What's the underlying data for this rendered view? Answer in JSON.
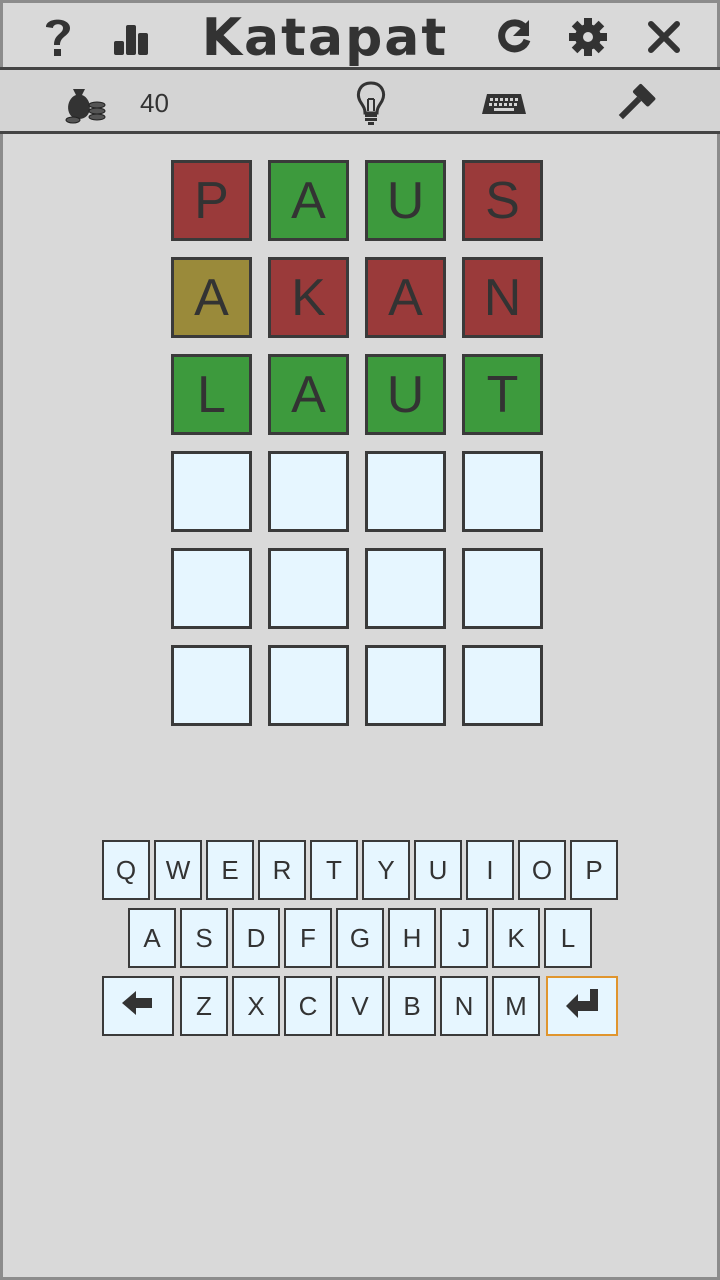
{
  "app": {
    "title": "Katapat"
  },
  "header": {
    "icons": [
      "help-icon",
      "stats-icon",
      "restart-icon",
      "settings-icon",
      "close-icon"
    ]
  },
  "toolbar": {
    "coins": "40",
    "icons": [
      "coin-bag-icon",
      "hint-bulb-icon",
      "keyboard-icon",
      "hammer-icon"
    ]
  },
  "colors": {
    "correct": "#3d9a3d",
    "absent": "#9a3a3a",
    "present": "#9a8a3a",
    "empty": "#e6f6ff",
    "enter_border": "#e0952e"
  },
  "board": {
    "rows": [
      {
        "letters": [
          "P",
          "A",
          "U",
          "S"
        ],
        "states": [
          "absent",
          "correct",
          "correct",
          "absent"
        ]
      },
      {
        "letters": [
          "A",
          "K",
          "A",
          "N"
        ],
        "states": [
          "present",
          "absent",
          "absent",
          "absent"
        ]
      },
      {
        "letters": [
          "L",
          "A",
          "U",
          "T"
        ],
        "states": [
          "correct",
          "correct",
          "correct",
          "correct"
        ]
      },
      {
        "letters": [
          "",
          "",
          "",
          ""
        ],
        "states": [
          "empty",
          "empty",
          "empty",
          "empty"
        ]
      },
      {
        "letters": [
          "",
          "",
          "",
          ""
        ],
        "states": [
          "empty",
          "empty",
          "empty",
          "empty"
        ]
      },
      {
        "letters": [
          "",
          "",
          "",
          ""
        ],
        "states": [
          "empty",
          "empty",
          "empty",
          "empty"
        ]
      }
    ]
  },
  "keyboard": {
    "row1": [
      {
        "k": "Q",
        "s": "none"
      },
      {
        "k": "W",
        "s": "none"
      },
      {
        "k": "E",
        "s": "none"
      },
      {
        "k": "R",
        "s": "none"
      },
      {
        "k": "T",
        "s": "correct"
      },
      {
        "k": "Y",
        "s": "none"
      },
      {
        "k": "U",
        "s": "correct"
      },
      {
        "k": "I",
        "s": "none"
      },
      {
        "k": "O",
        "s": "none"
      },
      {
        "k": "P",
        "s": "absent"
      }
    ],
    "row2": [
      {
        "k": "A",
        "s": "correct"
      },
      {
        "k": "S",
        "s": "absent"
      },
      {
        "k": "D",
        "s": "none"
      },
      {
        "k": "F",
        "s": "none"
      },
      {
        "k": "G",
        "s": "none"
      },
      {
        "k": "H",
        "s": "none"
      },
      {
        "k": "J",
        "s": "none"
      },
      {
        "k": "K",
        "s": "absent"
      },
      {
        "k": "L",
        "s": "correct"
      }
    ],
    "row3": [
      {
        "k": "Z",
        "s": "none"
      },
      {
        "k": "X",
        "s": "none"
      },
      {
        "k": "C",
        "s": "none"
      },
      {
        "k": "V",
        "s": "none"
      },
      {
        "k": "B",
        "s": "none"
      },
      {
        "k": "N",
        "s": "absent"
      },
      {
        "k": "M",
        "s": "none"
      }
    ],
    "backspace_icon": "backspace-arrow-icon",
    "enter_icon": "enter-return-icon"
  }
}
